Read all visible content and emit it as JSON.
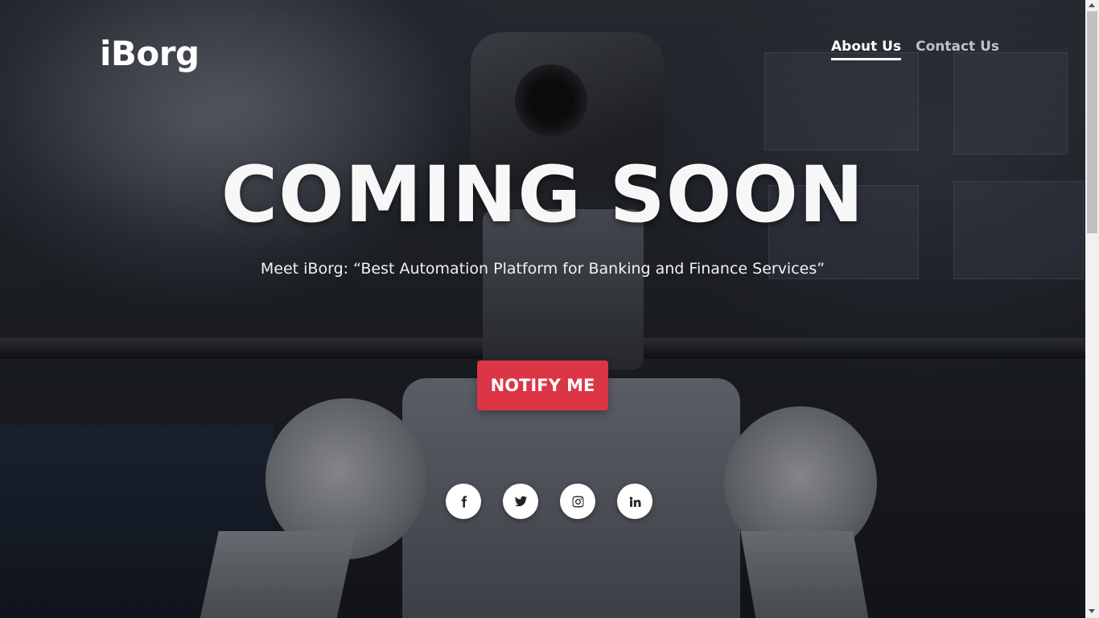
{
  "brand": {
    "logo": "iBorg"
  },
  "nav": {
    "items": [
      {
        "label": "About Us",
        "active": true
      },
      {
        "label": "Contact Us",
        "active": false
      }
    ]
  },
  "hero": {
    "headline": "COMING SOON",
    "tagline": "Meet iBorg: “Best Automation Platform for Banking and Finance Services”",
    "cta_label": "NOTIFY ME"
  },
  "social": {
    "icons": [
      "facebook-icon",
      "twitter-icon",
      "instagram-icon",
      "linkedin-icon"
    ]
  },
  "colors": {
    "accent": "#dc3545",
    "text": "#ffffff",
    "nav_inactive": "#bfc1c6"
  }
}
